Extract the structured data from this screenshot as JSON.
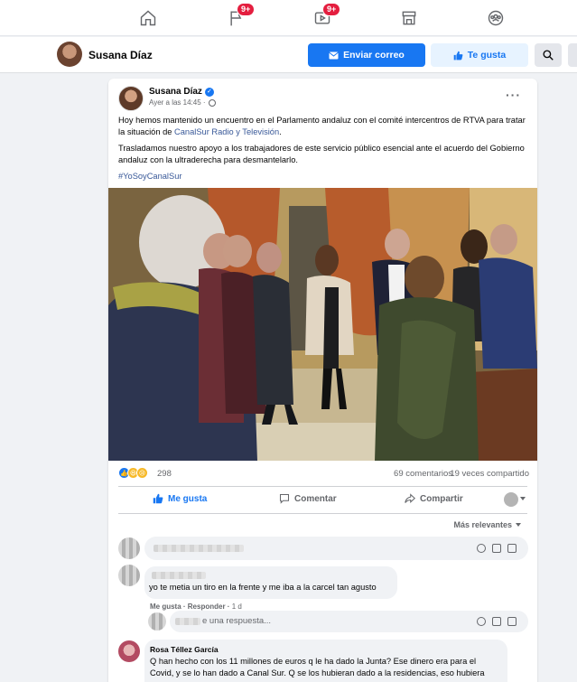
{
  "topnav": {
    "items": [
      {
        "icon": "home-icon",
        "badge": ""
      },
      {
        "icon": "flag-icon",
        "badge": "9+"
      },
      {
        "icon": "video-icon",
        "badge": "9+"
      },
      {
        "icon": "store-icon",
        "badge": ""
      },
      {
        "icon": "groups-icon",
        "badge": ""
      }
    ]
  },
  "profile_bar": {
    "name": "Susana Díaz",
    "email_button": "Enviar correo",
    "like_button": "Te gusta"
  },
  "post": {
    "author": "Susana Díaz",
    "time": "Ayer a las 14:45 ·",
    "paragraph1_before": "Hoy hemos mantenido un encuentro en el Parlamento andaluz con el comité intercentros de RTVA para tratar la situación de ",
    "paragraph1_link": "CanalSur Radio y Televisión",
    "paragraph1_after": ".",
    "paragraph2": "Trasladamos nuestro apoyo a los trabajadores de este servicio público esencial ante el acuerdo del Gobierno andaluz con la ultraderecha para desmantelarlo.",
    "hashtag": "#YoSoyCanalSur",
    "reactions_count": "298",
    "comments_count": "69 comentarios",
    "shares_count": "19 veces compartido",
    "actions": {
      "like": "Me gusta",
      "comment": "Comentar",
      "share": "Compartir"
    },
    "sort_label": "Más relevantes"
  },
  "comments": [
    {
      "text": "yo te metia un tiro en la frente y me iba a la carcel tan agusto",
      "actions": {
        "like": "Me gusta",
        "reply": "Responder",
        "time": "1 d"
      },
      "reply_placeholder": "e una respuesta..."
    },
    {
      "name": "Rosa Téllez García",
      "text_line1": "Q han hecho con los 11 millones de euros q le ha dado la Junta? Ese dinero era para el",
      "text_line2": "Covid, y se lo han dado a Canal Sur. Q se los hubieran dado a la residencias, eso hubiera"
    }
  ],
  "colors": {
    "brand_blue": "#1877f2",
    "badge_red": "#e41e3f",
    "background": "#f0f2f5"
  }
}
